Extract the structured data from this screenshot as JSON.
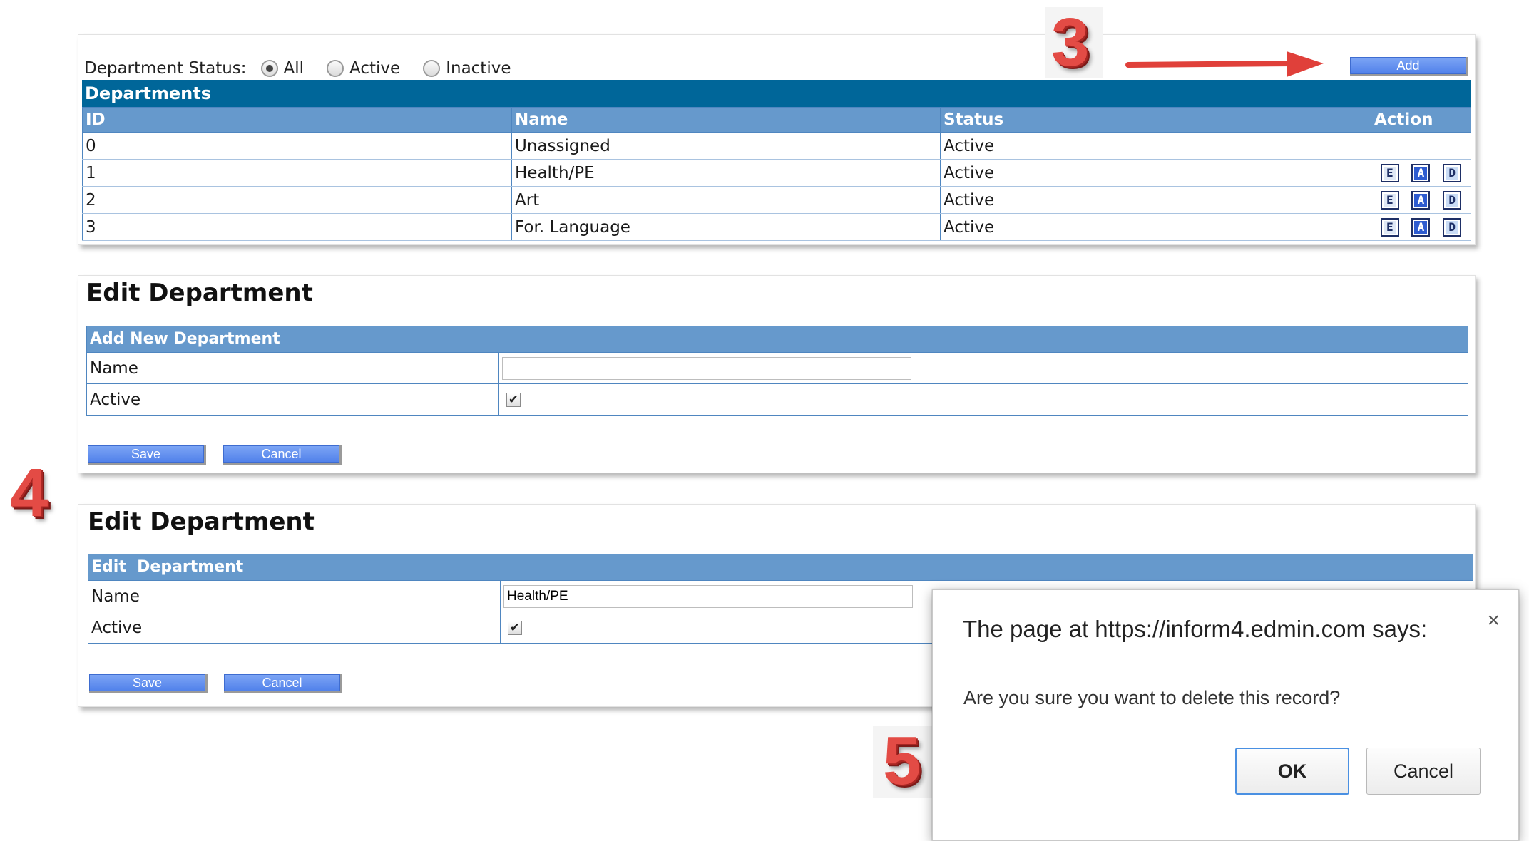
{
  "filter": {
    "label": "Department Status:",
    "options": [
      {
        "label": "All",
        "selected": true
      },
      {
        "label": "Active",
        "selected": false
      },
      {
        "label": "Inactive",
        "selected": false
      }
    ]
  },
  "toolbar": {
    "add_label": "Add"
  },
  "departments": {
    "title": "Departments",
    "columns": [
      "ID",
      "Name",
      "Status",
      "Action"
    ],
    "rows": [
      {
        "id": "0",
        "name": "Unassigned",
        "status": "Active"
      },
      {
        "id": "1",
        "name": "Health/PE",
        "status": "Active"
      },
      {
        "id": "2",
        "name": "Art",
        "status": "Active"
      },
      {
        "id": "3",
        "name": "For. Language",
        "status": "Active"
      }
    ],
    "action_icons": {
      "edit": "E",
      "activate": "A",
      "delete": "D"
    }
  },
  "add_panel": {
    "title": "Edit Department",
    "form_title": "Add New Department",
    "name_label": "Name",
    "name_value": "",
    "active_label": "Active",
    "active_checked": true,
    "save_label": "Save",
    "cancel_label": "Cancel"
  },
  "edit_panel": {
    "title": "Edit Department",
    "form_title": "Edit  Department",
    "name_label": "Name",
    "name_value": "Health/PE",
    "active_label": "Active",
    "active_checked": true,
    "save_label": "Save",
    "cancel_label": "Cancel"
  },
  "dialog": {
    "title": "The page at https://inform4.edmin.com says:",
    "message": "Are you sure you want to delete this record?",
    "ok_label": "OK",
    "cancel_label": "Cancel",
    "close_glyph": "×"
  },
  "steps": {
    "step3": "3",
    "step4": "4",
    "step5": "5"
  },
  "colors": {
    "header_dark": "#006699",
    "header_light": "#6699cc",
    "button_blue": "#4f80ea",
    "step_red": "#e34b45"
  }
}
